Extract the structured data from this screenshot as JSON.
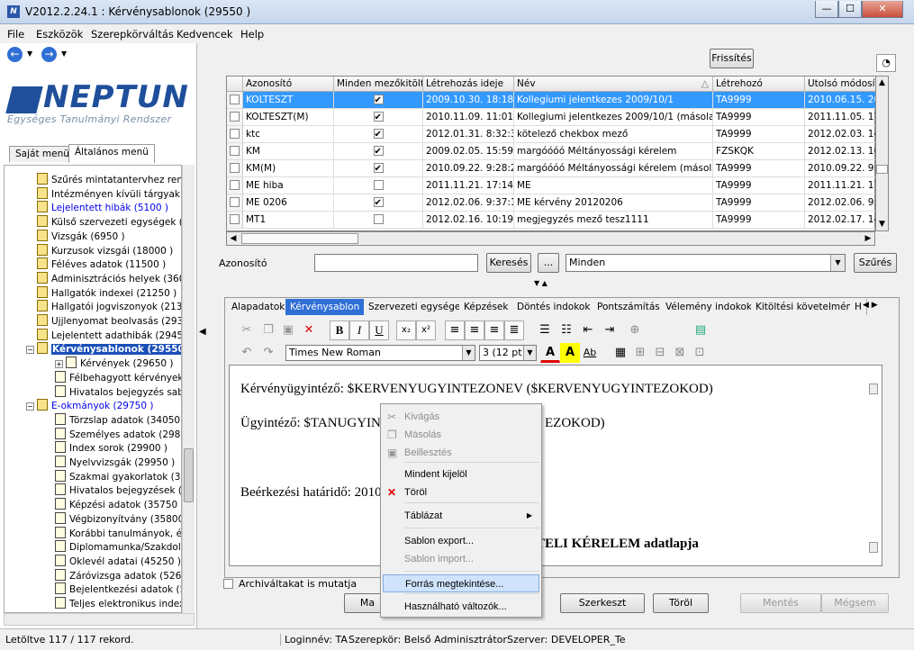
{
  "window": {
    "title": "V2012.2.24.1 : Kérvénysablonok (29550  )",
    "min": "—",
    "max": "☐",
    "close": "✕"
  },
  "menu": [
    "File",
    "Eszközök",
    "Szerepkörváltás",
    "Kedvencek",
    "Help"
  ],
  "logo": {
    "name": "NEPTUN",
    "subtitle": "Egységes Tanulmányi Rendszer"
  },
  "left_tabs": [
    "Saját menü",
    "Általános menü"
  ],
  "tree": [
    {
      "label": "Szűrés mintatantervhez rende",
      "style": "n",
      "indent": 40
    },
    {
      "label": "Intézményen kívüli tárgyak (4",
      "style": "n",
      "indent": 40
    },
    {
      "label": "Lejelentett hibák (5100 )",
      "style": "link",
      "indent": 40
    },
    {
      "label": "Külső szervezeti egységek (6",
      "style": "n",
      "indent": 40
    },
    {
      "label": "Vizsgák (6950 )",
      "style": "n",
      "indent": 40
    },
    {
      "label": "Kurzusok vizsgái (18000 )",
      "style": "n",
      "indent": 40
    },
    {
      "label": "Féléves adatok (11500 )",
      "style": "n",
      "indent": 40
    },
    {
      "label": "Adminisztrációs helyek (3600",
      "style": "n",
      "indent": 40
    },
    {
      "label": "Hallgatók indexei (21250 )",
      "style": "n",
      "indent": 40
    },
    {
      "label": "Hallgatói jogviszonyok (21300",
      "style": "n",
      "indent": 40
    },
    {
      "label": "Ujjlenyomat beolvasás (29300",
      "style": "n",
      "indent": 40
    },
    {
      "label": "Lejelentett adathibák (29450",
      "style": "n",
      "indent": 40
    },
    {
      "label": "Kérvénysablonok (29550",
      "style": "bold",
      "indent": 28,
      "expander": "−"
    },
    {
      "label": "Kérvények (29650 )",
      "style": "n",
      "indent": 60,
      "expander": "+"
    },
    {
      "label": "Félbehagyott kérvények",
      "style": "n",
      "indent": 60
    },
    {
      "label": "Hivatalos bejegyzés sabl",
      "style": "n",
      "indent": 60
    },
    {
      "label": "E-okmányok (29750 )",
      "style": "link",
      "indent": 28,
      "expander": "−"
    },
    {
      "label": "Törzslap adatok (34050",
      "style": "n",
      "indent": 60
    },
    {
      "label": "Személyes adatok (29850",
      "style": "n",
      "indent": 60
    },
    {
      "label": "Index sorok (29900 )",
      "style": "n",
      "indent": 60
    },
    {
      "label": "Nyelvvizsgák (29950 )",
      "style": "n",
      "indent": 60
    },
    {
      "label": "Szakmai gyakorlatok (30",
      "style": "n",
      "indent": 60
    },
    {
      "label": "Hivatalos bejegyzések (3",
      "style": "n",
      "indent": 60
    },
    {
      "label": "Képzési adatok (35750 )",
      "style": "n",
      "indent": 60
    },
    {
      "label": "Végbizonyítvány (35800",
      "style": "n",
      "indent": 60
    },
    {
      "label": "Korábbi tanulmányok, ére",
      "style": "n",
      "indent": 60
    },
    {
      "label": "Diplomamunka/Szakdolg",
      "style": "n",
      "indent": 60
    },
    {
      "label": "Oklevél adatai (45250 )",
      "style": "n",
      "indent": 60
    },
    {
      "label": "Záróvizsga adatok (5265",
      "style": "n",
      "indent": 60
    },
    {
      "label": "Bejelentkezési adatok (5",
      "style": "n",
      "indent": 60
    },
    {
      "label": "Teljes elektronikus index",
      "style": "n",
      "indent": 60
    }
  ],
  "grid": {
    "refresh": "Frissítés",
    "columns": [
      "Azonosító",
      "Minden mezőkitölt...",
      "Létrehozás ideje",
      "Név",
      "Létrehozó",
      "Utolsó módosítá"
    ],
    "rows": [
      {
        "id": "KOLTESZT",
        "all": true,
        "created": "2009.10.30. 18:18:2",
        "name": "Kollegiumi jelentkezes 2009/10/1",
        "creator": "TA9999",
        "modified": "2010.06.15. 20",
        "selected": true
      },
      {
        "id": "KOLTESZT(M)",
        "all": true,
        "created": "2010.11.09. 11:01:3",
        "name": "Kollegiumi jelentkezes 2009/10/1 (másolat)",
        "creator": "TA9999",
        "modified": "2011.11.05. 17:",
        "selected": false
      },
      {
        "id": "ktc",
        "all": true,
        "created": "2012.01.31. 8:32:35",
        "name": "kötelező chekbox mező",
        "creator": "TA9999",
        "modified": "2012.02.03. 14:",
        "selected": false
      },
      {
        "id": "KM",
        "all": true,
        "created": "2009.02.05. 15:59:1",
        "name": "margóóóó Méltányossági kérelem",
        "creator": "FZSKQK",
        "modified": "2012.02.13. 16:",
        "selected": false
      },
      {
        "id": "KM(M)",
        "all": true,
        "created": "2010.09.22. 9:28:22",
        "name": "margóóóó Méltányossági kérelem (másolat)",
        "creator": "TA9999",
        "modified": "2010.09.22. 9:2",
        "selected": false
      },
      {
        "id": "ME hiba",
        "all": false,
        "created": "2011.11.21. 17:14:5",
        "name": "ME",
        "creator": "TA9999",
        "modified": "2011.11.21. 17:",
        "selected": false
      },
      {
        "id": "ME 0206",
        "all": true,
        "created": "2012.02.06. 9:37:18",
        "name": "ME kérvény 20120206",
        "creator": "TA9999",
        "modified": "2012.02.06. 9:3",
        "selected": false
      },
      {
        "id": "MT1",
        "all": false,
        "created": "2012.02.16. 10:19:4",
        "name": "megjegyzés mező tesz1111",
        "creator": "TA9999",
        "modified": "2012.02.17. 14:",
        "selected": false
      }
    ]
  },
  "filter": {
    "label": "Azonosító",
    "value": "",
    "search": "Keresés",
    "dots": "...",
    "scope": "Minden",
    "filter_btn": "Szűrés"
  },
  "tabs": [
    "Alapadatok",
    "Kérvénysablon",
    "Szervezeti egységek",
    "Képzések",
    "Döntés indokok",
    "Pontszámítás",
    "Vélemény indokok",
    "Kitöltési követelmény",
    "H"
  ],
  "toolbar": {
    "font": "Times New Roman",
    "size": "3  (12 pt)"
  },
  "editor": {
    "lines": [
      "Kérvényügyintéző: $KERVENYUGYINTEZONEV ($KERVENYUGYINTEZOKOD)",
      "Ügyintéző: $TANUGYIN",
      "EZOKOD)",
      "Beérkezési határidő: 2010",
      "TELI KÉRELEM adatlapja"
    ]
  },
  "context_menu": {
    "items": [
      {
        "label": "Kivágás",
        "enabled": false,
        "icon": "cut-icon"
      },
      {
        "label": "Másolás",
        "enabled": false,
        "icon": "copy-icon"
      },
      {
        "label": "Beillesztés",
        "enabled": false,
        "icon": "paste-icon"
      },
      {
        "label": "Mindent kijelöl",
        "enabled": true
      },
      {
        "label": "Töröl",
        "enabled": true,
        "icon": "delete-icon"
      },
      {
        "label": "Táblázat",
        "enabled": true,
        "submenu": true
      },
      {
        "label": "Sablon export...",
        "enabled": true
      },
      {
        "label": "Sablon import...",
        "enabled": false
      },
      {
        "label": "Forrás megtekintése...",
        "enabled": true,
        "highlighted": true
      },
      {
        "label": "Használható változók...",
        "enabled": true
      }
    ]
  },
  "archived": "Archiváltakat is mutatja",
  "buttons": {
    "new": "Ma",
    "edit": "Szerkeszt",
    "delete": "Töröl",
    "save": "Mentés",
    "cancel": "Mégsem"
  },
  "status": {
    "loaded": "Letöltve 117 / 117 rekord.",
    "login": "Loginnév: TA",
    "role": "Szerepkör: Belső Adminisztrátor",
    "server": "Szerver: DEVELOPER_Te"
  }
}
